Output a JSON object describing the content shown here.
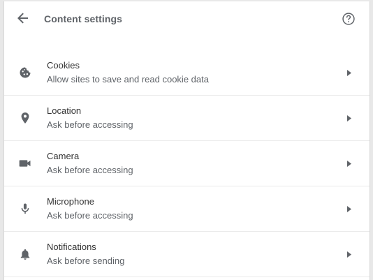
{
  "header": {
    "title": "Content settings",
    "back_icon": "arrow-back-icon",
    "help_icon": "help-circle-icon"
  },
  "items": [
    {
      "key": "cookies",
      "icon": "cookie-icon",
      "title": "Cookies",
      "subtitle": "Allow sites to save and read cookie data"
    },
    {
      "key": "location",
      "icon": "location-pin-icon",
      "title": "Location",
      "subtitle": "Ask before accessing"
    },
    {
      "key": "camera",
      "icon": "camera-icon",
      "title": "Camera",
      "subtitle": "Ask before accessing"
    },
    {
      "key": "microphone",
      "icon": "microphone-icon",
      "title": "Microphone",
      "subtitle": "Ask before accessing"
    },
    {
      "key": "notifications",
      "icon": "bell-icon",
      "title": "Notifications",
      "subtitle": "Ask before sending"
    }
  ],
  "colors": {
    "icon": "#5f6368",
    "text_primary": "#333333",
    "text_secondary": "#5f6368",
    "divider": "#ebebeb"
  }
}
